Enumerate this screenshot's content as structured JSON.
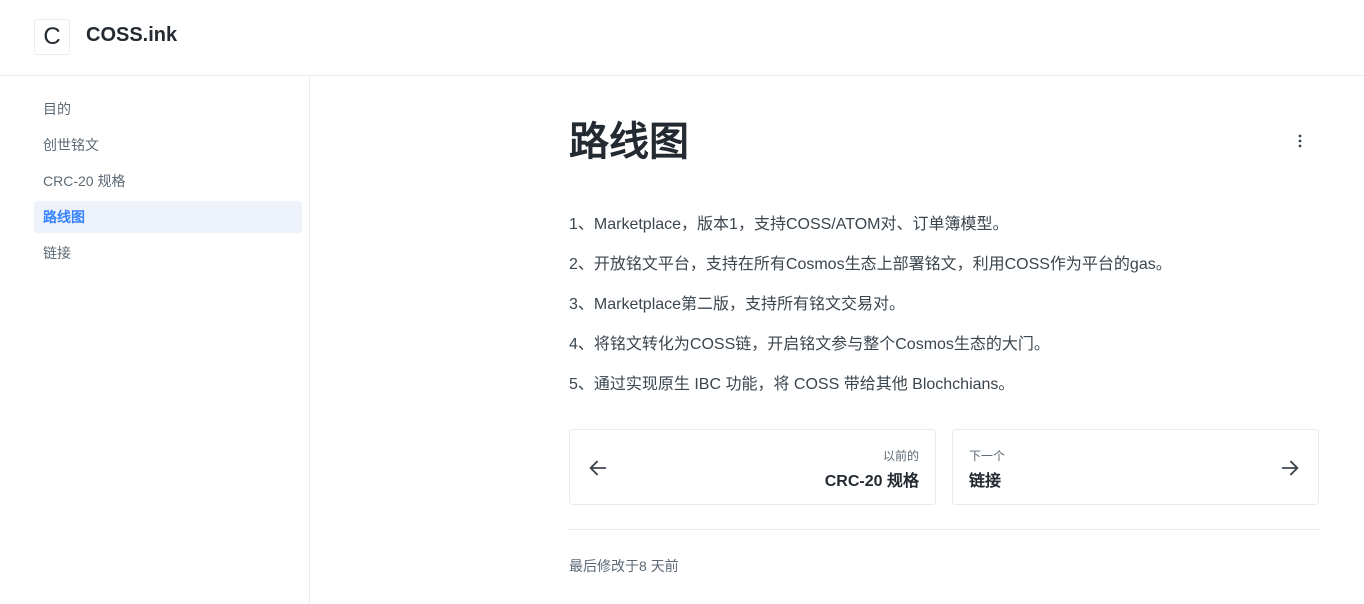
{
  "header": {
    "logo_letter": "C",
    "site_title": "COSS.ink"
  },
  "sidebar": {
    "items": [
      {
        "label": "目的"
      },
      {
        "label": "创世铭文"
      },
      {
        "label": "CRC-20 规格"
      },
      {
        "label": "路线图",
        "active": true
      },
      {
        "label": "链接"
      }
    ]
  },
  "main": {
    "title": "路线图",
    "more_icon": "more-vertical-icon",
    "paragraphs": [
      "1、Marketplace，版本1，支持COSS/ATOM对、订单簿模型。",
      "2、开放铭文平台，支持在所有Cosmos生态上部署铭文，利用COSS作为平台的gas。",
      "3、Marketplace第二版，支持所有铭文交易对。",
      "4、将铭文转化为COSS链，开启铭文参与整个Cosmos生态的大门。",
      "5、通过实现原生 IBC 功能，将 COSS 带给其他 Blochchians。"
    ],
    "prev": {
      "hint": "以前的",
      "title": "CRC-20 规格",
      "icon": "arrow-left-icon"
    },
    "next": {
      "hint": "下一个",
      "title": "链接",
      "icon": "arrow-right-icon"
    },
    "last_modified": "最后修改于8 天前"
  },
  "colors": {
    "accent": "#3884ff",
    "active_bg": "#eef2fb",
    "border": "#e6ecf1",
    "text": "#242a31",
    "muted": "#5c6975"
  }
}
